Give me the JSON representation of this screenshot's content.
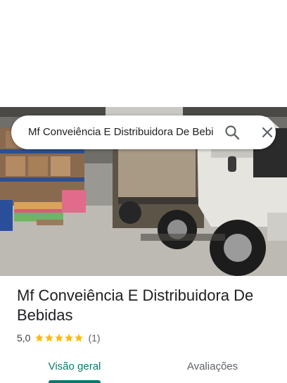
{
  "search": {
    "query": "Mf Conveiência E Distribuidora De Bebidas"
  },
  "place": {
    "name": "Mf Conveiência E Distribuidora De Bebidas",
    "rating": "5,0",
    "stars": 5,
    "review_count": "(1)"
  },
  "tabs": [
    {
      "label": "Visão geral",
      "active": true
    },
    {
      "label": "Avaliações",
      "active": false
    }
  ],
  "colors": {
    "accent": "#0b7a6d",
    "star": "#fbbc04"
  },
  "icons": {
    "search": "search-icon",
    "close": "close-icon",
    "star": "star-icon"
  }
}
